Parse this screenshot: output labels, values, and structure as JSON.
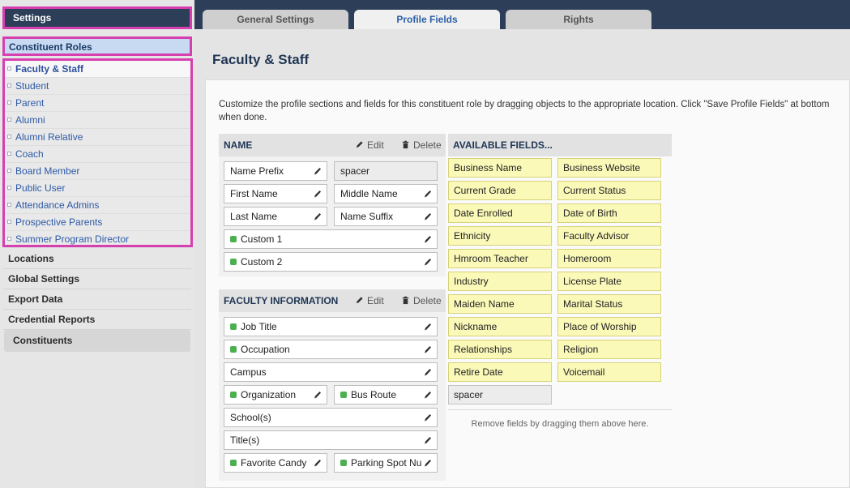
{
  "sidebar": {
    "header": "Settings",
    "roles_title": "Constituent Roles",
    "roles": [
      "Faculty & Staff",
      "Student",
      "Parent",
      "Alumni",
      "Alumni Relative",
      "Coach",
      "Board Member",
      "Public User",
      "Attendance Admins",
      "Prospective Parents",
      "Summer Program Director"
    ],
    "links": [
      "Locations",
      "Global Settings",
      "Export Data",
      "Credential Reports"
    ],
    "constituents": "Constituents"
  },
  "tabs": [
    "General Settings",
    "Profile Fields",
    "Rights"
  ],
  "page_title": "Faculty & Staff",
  "intro": "Customize the profile sections and fields for this constituent role by dragging objects to the appropriate location. Click \"Save Profile Fields\" at bottom when done.",
  "actions": {
    "edit": "Edit",
    "delete": "Delete"
  },
  "sections": [
    {
      "title": "NAME",
      "fields": [
        "Name Prefix",
        "spacer",
        "First Name",
        "Middle Name",
        "Last Name",
        "Name Suffix",
        "Custom 1",
        "Custom 2"
      ]
    },
    {
      "title": "FACULTY INFORMATION",
      "fields": [
        "Job Title",
        "Occupation",
        "Campus",
        "Organization",
        "Bus Route",
        "School(s)",
        "Title(s)",
        "Favorite Candy",
        "Parking Spot Nu"
      ]
    }
  ],
  "available": {
    "title": "AVAILABLE FIELDS...",
    "fields": [
      "Business Name",
      "Business Website",
      "Current Grade",
      "Current Status",
      "Date Enrolled",
      "Date of Birth",
      "Ethnicity",
      "Faculty Advisor",
      "Hmroom Teacher",
      "Homeroom",
      "Industry",
      "License Plate",
      "Maiden Name",
      "Marital Status",
      "Nickname",
      "Place of Worship",
      "Relationships",
      "Religion",
      "Retire Date",
      "Voicemail",
      "spacer"
    ],
    "remove_note": "Remove fields by dragging them above here."
  },
  "colors": {
    "nav": "#2c3e58",
    "highlight": "#d63fb0",
    "active_tab": "#2c5fa6",
    "available": "#fbf9b8",
    "custom_dot": "#4caf50"
  }
}
